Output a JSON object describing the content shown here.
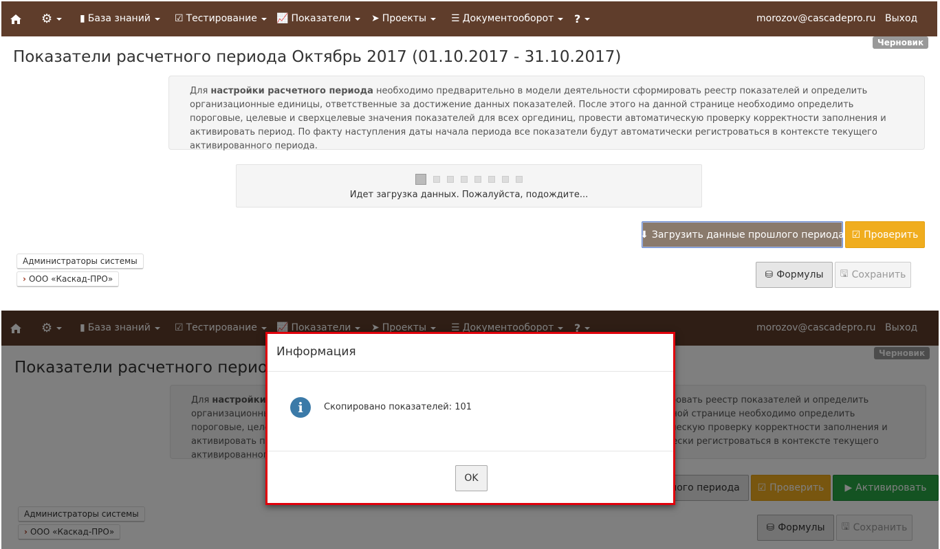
{
  "nav": {
    "knowledge": "База знаний",
    "testing": "Тестирование",
    "indicators": "Показатели",
    "projects": "Проекты",
    "docflow": "Документооборот",
    "user_email": "morozov@cascadepro.ru",
    "logout": "Выход"
  },
  "page": {
    "badge": "Черновик",
    "title": "Показатели расчетного периода Октябрь 2017 (01.10.2017 - 31.10.2017)",
    "title_truncated": "Показатели расчетного периода",
    "info_prefix": "Для ",
    "info_bold": "настройки расчетного периода",
    "info_rest": " необходимо предварительно в модели деятельности сформировать реестр показателей и определить организационные единицы, ответственные за достижение данных показателей. После этого на данной странице необходимо определить пороговые, целевые и сверхцелевые значения показателей для всех оргединиц, провести автоматическую проверку корректности заполнения и активировать период. По факту наступления даты начала периода все показатели будут автоматически регистроваться в контексте текущего активированного периода.",
    "loading_text": "Идет загрузка данных. Пожалуйста, подождите...",
    "loading_dot_count": 8
  },
  "buttons": {
    "load_previous": "Загрузить данные прошлого периода",
    "load_previous_partial": "лого периода",
    "check": "Проверить",
    "activate": "Активировать",
    "formulas": "Формулы",
    "save": "Сохранить",
    "ok": "OK"
  },
  "orgs": {
    "admins": "Администраторы системы",
    "company": "ООО «Каскад-ПРО»"
  },
  "modal": {
    "title": "Информация",
    "message": "Скопировано показателей: 101"
  },
  "colors": {
    "navbar": "#5f3d2b",
    "warning": "#f0ad1e",
    "success": "#28a745",
    "modal_border": "#e0000b",
    "info_icon": "#3b7aa8"
  }
}
